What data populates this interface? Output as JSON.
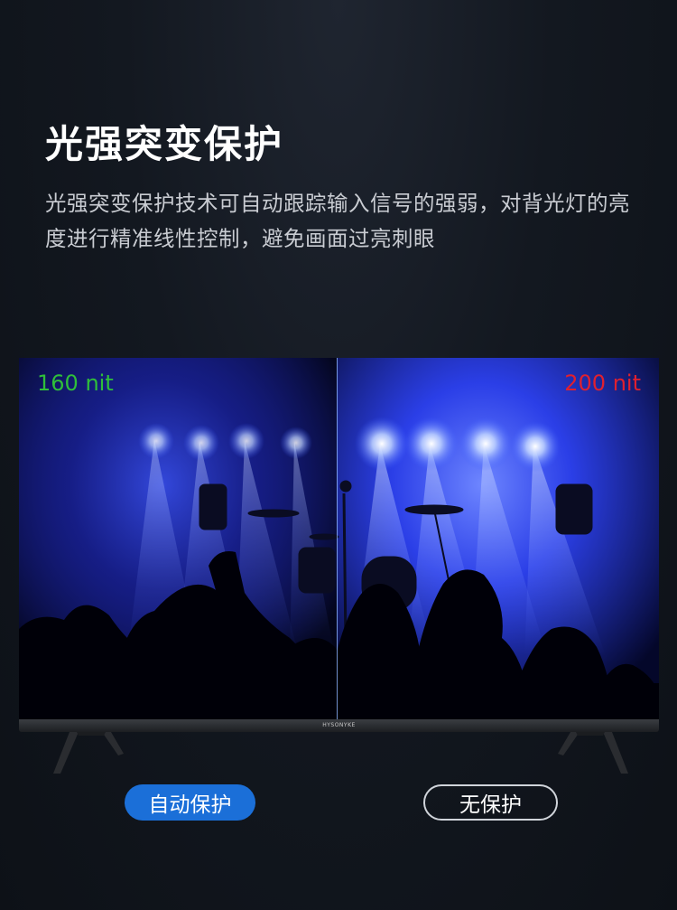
{
  "heading": {
    "title": "光强突变保护",
    "description": "光强突变保护技术可自动跟踪输入信号的强弱，对背光灯的亮度进行精准线性控制，避免画面过亮刺眼"
  },
  "tv": {
    "left_label": "160 nit",
    "right_label": "200 nit",
    "brand": "HYSONYKE",
    "left_label_color": "#2fbf3a",
    "right_label_color": "#e0202f"
  },
  "buttons": {
    "auto_label": "自动保护",
    "none_label": "无保护"
  },
  "colors": {
    "accent": "#1b6fd8",
    "background": "#131820"
  }
}
